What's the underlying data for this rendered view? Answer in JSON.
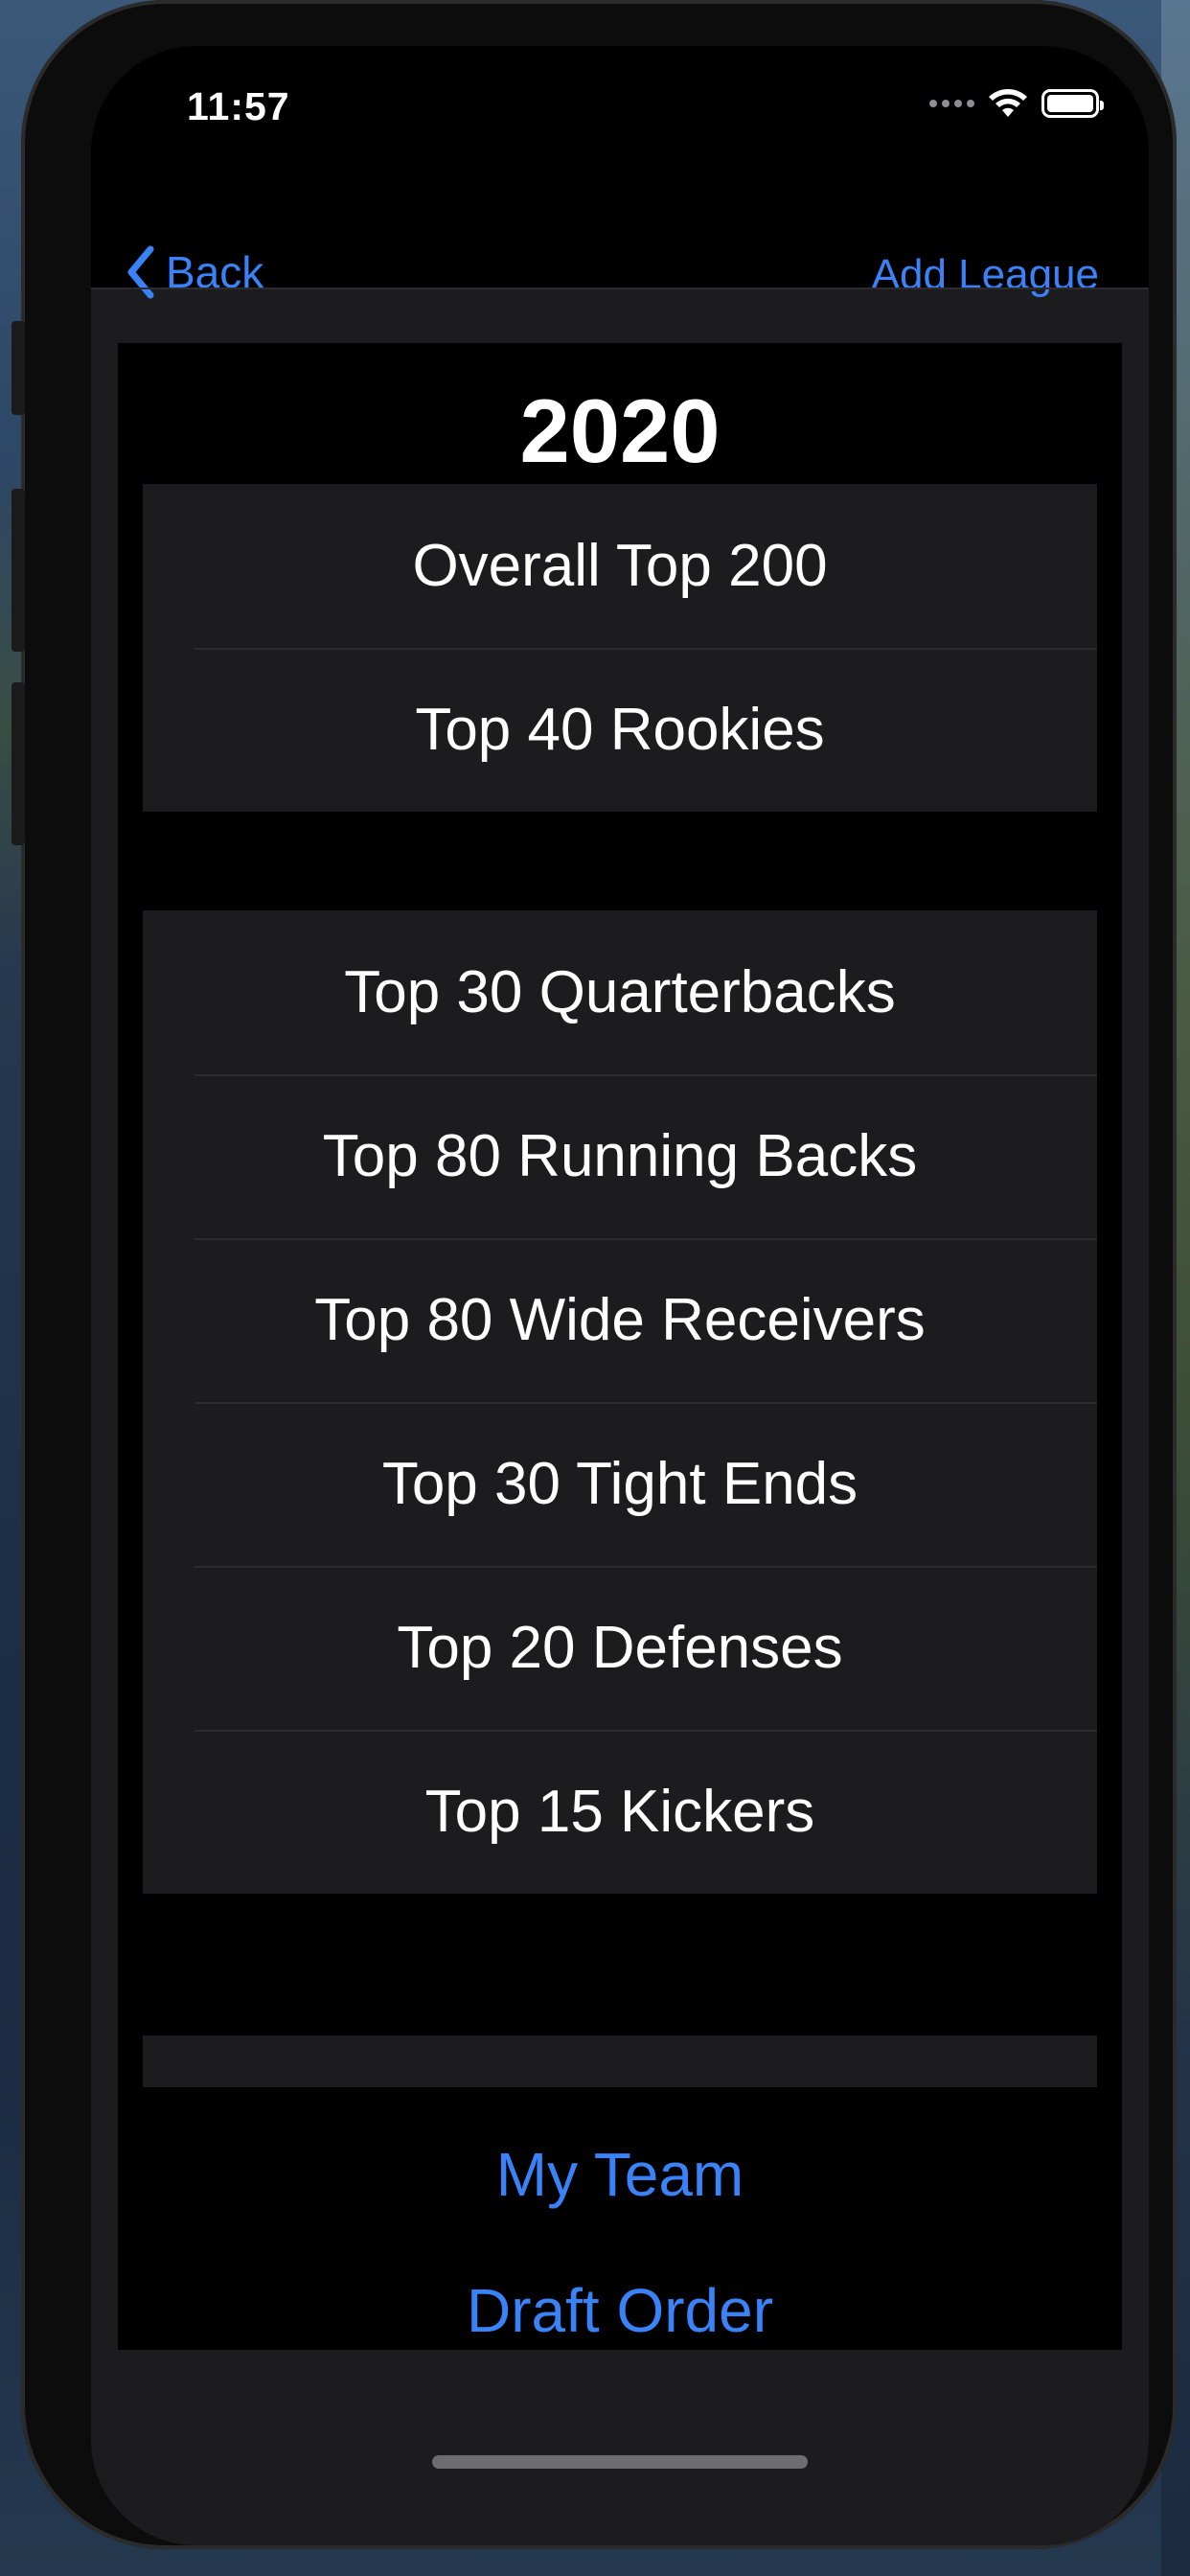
{
  "status_bar": {
    "time": "11:57"
  },
  "nav": {
    "back_label": "Back",
    "right_label": "Add League"
  },
  "section": {
    "year": "2020"
  },
  "group1": [
    {
      "label": "Overall Top 200"
    },
    {
      "label": "Top 40 Rookies"
    }
  ],
  "group2": [
    {
      "label": "Top 30 Quarterbacks"
    },
    {
      "label": "Top 80 Running Backs"
    },
    {
      "label": "Top 80 Wide Receivers"
    },
    {
      "label": "Top 30 Tight Ends"
    },
    {
      "label": "Top 20 Defenses"
    },
    {
      "label": "Top 15 Kickers"
    }
  ],
  "links": {
    "my_team": "My Team",
    "draft_order": "Draft Order"
  },
  "colors": {
    "accent": "#3a82f7",
    "cell_background": "#1c1c1e",
    "background": "#000000"
  },
  "icons": {
    "back": "chevron-left-icon",
    "wifi": "wifi-icon",
    "battery": "battery-icon",
    "signal": "signal-icon"
  }
}
